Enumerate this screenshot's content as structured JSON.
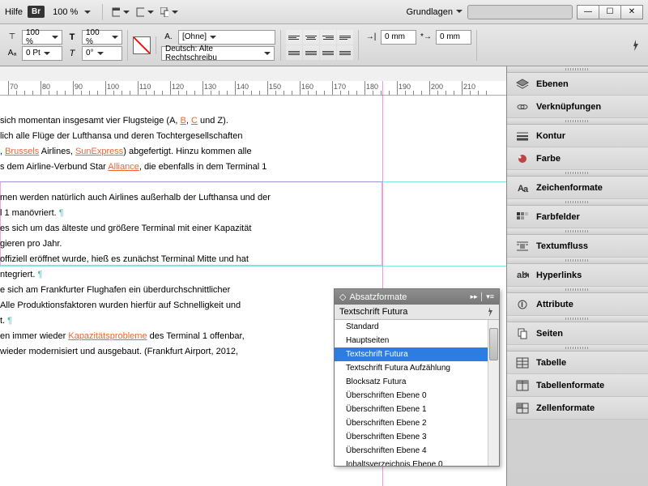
{
  "topbar": {
    "help": "Hilfe",
    "br": "Br",
    "zoom": "100 %",
    "workspace": "Grundlagen",
    "search_placeholder": ""
  },
  "toolbar": {
    "scaleX": "100 %",
    "scaleY": "100 %",
    "kerning": "0",
    "leading": "0 Pt",
    "skew": "0°",
    "charstyle": "[Ohne]",
    "language": "Deutsch: Alte Rechtschreibu",
    "indent1": "0 mm",
    "indent2": "0 mm"
  },
  "ruler": {
    "ticks": [
      70,
      80,
      90,
      100,
      110,
      120,
      130,
      140,
      150,
      160,
      170,
      180,
      190,
      200,
      210
    ]
  },
  "document": {
    "lines": [
      "sich momentan insgesamt vier Flugsteige (A, <u>B</u>, <u>C</u> und Z).",
      "lich alle Flüge der Lufthansa und deren Tochtergesellschaften",
      ", <u>Brussels</u> Airlines, <u>SunExpress</u>) abgefertigt. Hinzu kommen alle",
      "s dem Airline-Verbund Star <u>Alliance</u>, die ebenfalls in dem Terminal 1",
      "",
      "men werden natürlich auch Airlines außerhalb der Lufthansa und der",
      "l 1 manövriert. <p>¶</p>",
      "es sich um das älteste und größere Terminal mit einer Kapazität",
      "gieren pro Jahr.",
      " offiziell eröffnet wurde, hieß es zunächst Terminal Mitte und hat",
      "ntegriert. <p>¶</p>",
      "e sich am Frankfurter Flughafen ein überdurchschnittlicher",
      " Alle Produktionsfaktoren wurden hierfür auf Schnelligkeit und",
      "t. <p>¶</p>",
      "en immer wieder <u>Kapazitätsprobleme</u> des Terminal 1 offenbar,",
      "wieder modernisiert und ausgebaut. (Frankfurt Airport, 2012,"
    ]
  },
  "popup": {
    "title": "Absatzformate",
    "current": "Textschrift Futura",
    "items": [
      "Standard",
      "Hauptseiten",
      "Textschrift Futura",
      "Textschrift Futura Aufzählung",
      "Blocksatz Futura",
      "Überschriften Ebene 0",
      "Überschriften Ebene 1",
      "Überschriften Ebene 2",
      "Überschriften Ebene 3",
      "Überschriften Ebene 4",
      "Inhaltsverzeichnis Ebene 0"
    ],
    "selected_index": 2
  },
  "panels": {
    "items": [
      {
        "label": "Ebenen",
        "icon": "layers"
      },
      {
        "label": "Verknüpfungen",
        "icon": "links"
      },
      {
        "label": "Kontur",
        "icon": "stroke"
      },
      {
        "label": "Farbe",
        "icon": "color"
      },
      {
        "label": "Zeichenformate",
        "icon": "charstyle"
      },
      {
        "label": "Farbfelder",
        "icon": "swatches"
      },
      {
        "label": "Textumfluss",
        "icon": "wrap"
      },
      {
        "label": "Hyperlinks",
        "icon": "hyperlink"
      },
      {
        "label": "Attribute",
        "icon": "attributes"
      },
      {
        "label": "Seiten",
        "icon": "pages"
      },
      {
        "label": "Tabelle",
        "icon": "table"
      },
      {
        "label": "Tabellenformate",
        "icon": "tablestyle"
      },
      {
        "label": "Zellenformate",
        "icon": "cellstyle"
      }
    ]
  }
}
